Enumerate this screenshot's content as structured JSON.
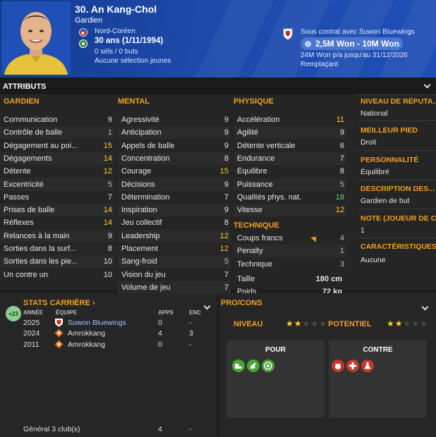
{
  "player": {
    "name": "30. An Kang-Chol",
    "position": "Gardien",
    "nationality": "Nord-Coréen",
    "age": "30 ans (1/11/1994)",
    "caps": "0 séls / 0 buts",
    "youth": "Aucune sélection jeunes"
  },
  "contract": {
    "status": "Sous contrat avec Suwon Bluewings",
    "value": "2,5M Won - 10M Won",
    "wage": "24M Won p/a jusqu'au 31/12/2026",
    "role": "Remplaçant"
  },
  "attributes": {
    "title": "ATTRIBUTS",
    "gardien": {
      "heading": "GARDIEN",
      "rows": [
        {
          "label": "Communication",
          "value": "9"
        },
        {
          "label": "Contrôle de balle",
          "value": "1"
        },
        {
          "label": "Dégagement au poi...",
          "value": "15"
        },
        {
          "label": "Dégagements",
          "value": "14"
        },
        {
          "label": "Détente",
          "value": "12"
        },
        {
          "label": "Excentricité",
          "value": "5"
        },
        {
          "label": "Passes",
          "value": "7"
        },
        {
          "label": "Prises de balle",
          "value": "14"
        },
        {
          "label": "Réflexes",
          "value": "14"
        },
        {
          "label": "Relances à la main",
          "value": "9"
        },
        {
          "label": "Sorties dans la surf...",
          "value": "8"
        },
        {
          "label": "Sorties dans les pie...",
          "value": "10"
        },
        {
          "label": "Un contre un",
          "value": "10"
        }
      ]
    },
    "mental": {
      "heading": "MENTAL",
      "rows": [
        {
          "label": "Agressivité",
          "value": "9"
        },
        {
          "label": "Anticipation",
          "value": "9"
        },
        {
          "label": "Appels de balle",
          "value": "9"
        },
        {
          "label": "Concentration",
          "value": "8"
        },
        {
          "label": "Courage",
          "value": "15"
        },
        {
          "label": "Décisions",
          "value": "9"
        },
        {
          "label": "Détermination",
          "value": "7"
        },
        {
          "label": "Inspiration",
          "value": "9"
        },
        {
          "label": "Jeu collectif",
          "value": "8"
        },
        {
          "label": "Leadership",
          "value": "12"
        },
        {
          "label": "Placement",
          "value": "12"
        },
        {
          "label": "Sang-froid",
          "value": "5"
        },
        {
          "label": "Vision du jeu",
          "value": "7"
        },
        {
          "label": "Volume de jeu",
          "value": "7"
        }
      ]
    },
    "physique": {
      "heading": "PHYSIQUE",
      "rows": [
        {
          "label": "Accélération",
          "value": "11"
        },
        {
          "label": "Agilité",
          "value": "9"
        },
        {
          "label": "Détente verticale",
          "value": "6"
        },
        {
          "label": "Endurance",
          "value": "7"
        },
        {
          "label": "Équilibre",
          "value": "8"
        },
        {
          "label": "Puissance",
          "value": "5"
        },
        {
          "label": "Qualités phys. nat.",
          "value": "18"
        },
        {
          "label": "Vitesse",
          "value": "12"
        }
      ]
    },
    "technique": {
      "heading": "TECHNIQUE",
      "rows": [
        {
          "label": "Coups francs",
          "value": "4"
        },
        {
          "label": "Penalty",
          "value": "1"
        },
        {
          "label": "Technique",
          "value": "3"
        }
      ],
      "height_label": "Taille",
      "height_value": "180 cm",
      "weight_label": "Poids",
      "weight_value": "72 kg"
    },
    "side": [
      {
        "heading": "NIVEAU DE RÉPUTA...",
        "value": "National"
      },
      {
        "heading": "MEILLEUR PIED",
        "value": "Droit"
      },
      {
        "heading": "PERSONNALITÉ",
        "value": "Équilibré"
      },
      {
        "heading": "DESCRIPTION DES...",
        "value": "Gardien de but"
      },
      {
        "heading": "NOTE (JOUEUR DE C...",
        "value": "1"
      },
      {
        "heading": "CARACTÉRISTIQUES J",
        "value": "Aucune"
      }
    ]
  },
  "career": {
    "title": "STATS CARRIÈRE",
    "badge": "+23",
    "headers": {
      "year": "ANNÉE",
      "team": "ÉQUIPE",
      "apps": "APPS",
      "enc": "ENC"
    },
    "rows": [
      {
        "year": "2025",
        "team": "Suwon Bluewings",
        "apps": "0",
        "enc": "-"
      },
      {
        "year": "2024",
        "team": "Amrokkang",
        "apps": "4",
        "enc": "3"
      },
      {
        "year": "2011",
        "team": "Amrokkang",
        "apps": "0",
        "enc": "-"
      }
    ],
    "footer": {
      "label": "Général 3 club(s)",
      "apps": "4",
      "enc": "-"
    }
  },
  "procons": {
    "title": "PRO/CONS",
    "niveau_label": "NIVEAU",
    "niveau_stars": 2,
    "potentiel_label": "POTENTIEL",
    "potentiel_stars": 2,
    "pour_label": "POUR",
    "contre_label": "CONTRE",
    "pour_icons": [
      "boot-icon",
      "strength-icon",
      "target-icon"
    ],
    "contre_icons": [
      "temper-icon",
      "injury-icon",
      "flask-icon"
    ]
  },
  "colors": {
    "header_blue": "#1d49aa",
    "accent_orange": "#f0a020",
    "value_yellow": "#ffd21f",
    "value_green": "#5ee06a"
  }
}
